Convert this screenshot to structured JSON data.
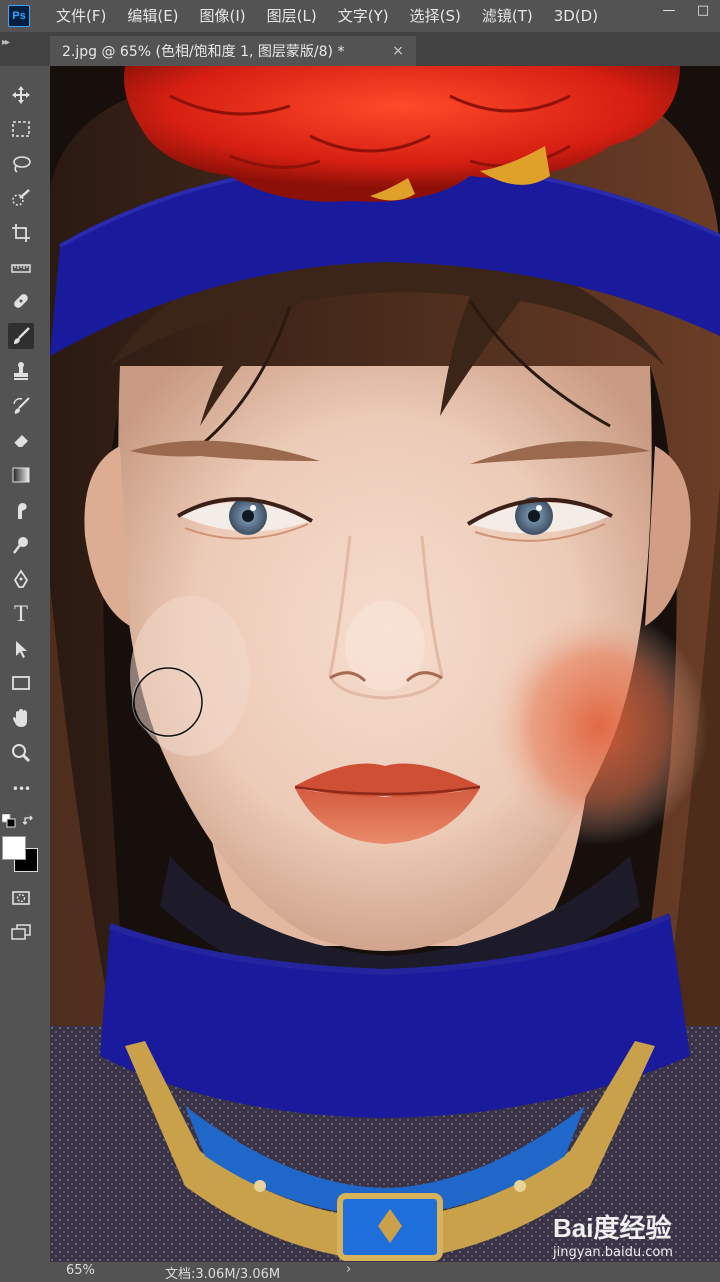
{
  "app": {
    "logo": "Ps",
    "menu": [
      "文件(F)",
      "编辑(E)",
      "图像(I)",
      "图层(L)",
      "文字(Y)",
      "选择(S)",
      "滤镜(T)",
      "3D(D)"
    ],
    "window_controls": {
      "minimize": "—",
      "maximize": "□"
    }
  },
  "document": {
    "tab_title": "2.jpg @ 65% (色相/饱和度 1, 图层蒙版/8) *",
    "close_glyph": "×"
  },
  "toolbar": {
    "active_tool": "brush",
    "tools": [
      "move",
      "marquee",
      "lasso",
      "quick-select",
      "crop",
      "ruler",
      "healing",
      "brush",
      "stamp",
      "history-brush",
      "eraser",
      "gradient",
      "smudge",
      "dodge",
      "pen",
      "type",
      "path-select",
      "rectangle",
      "hand",
      "zoom",
      "more"
    ],
    "type_tool_glyph": "T",
    "more_glyph": "•••",
    "foreground_color": "#ffffff",
    "background_color": "#000000"
  },
  "status": {
    "zoom": "65%",
    "doc_info": "文档:3.06M/3.06M",
    "arrow": "›"
  },
  "watermark": {
    "brand": "Bai度经验",
    "url": "jingyan.baidu.com"
  },
  "colors": {
    "ui_gray": "#535353",
    "tab_strip": "#424242",
    "ps_blue": "#31a8ff",
    "headband_blue": "#1a1a9c"
  }
}
